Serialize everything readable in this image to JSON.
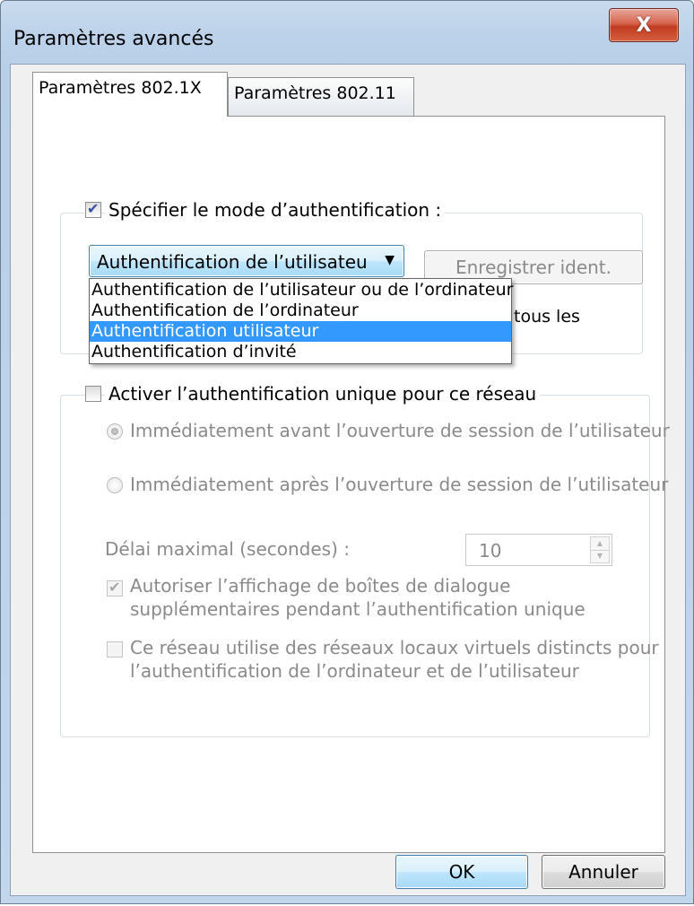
{
  "window": {
    "title": "Paramètres avancés",
    "close_glyph": "X"
  },
  "tabs": [
    {
      "label": "Paramètres 802.1X",
      "active": true
    },
    {
      "label": "Paramètres 802.11",
      "active": false
    }
  ],
  "auth_section": {
    "specify_mode_label": "Spécifier le mode d’authentification :",
    "specify_mode_checked": true,
    "mode_combo_value": "Authentification de l’utilisateur ou de l’ordinateur",
    "save_credentials_label": "Enregistrer ident.",
    "partially_hidden_text": "tous les",
    "dropdown_options": [
      {
        "label": "Authentification de l’utilisateur ou de l’ordinateur",
        "selected": false
      },
      {
        "label": "Authentification de l’ordinateur",
        "selected": false
      },
      {
        "label": "Authentification utilisateur",
        "selected": true
      },
      {
        "label": "Authentification d’invité",
        "selected": false
      }
    ]
  },
  "sso_section": {
    "enable_sso_label": "Activer l’authentification unique pour ce réseau",
    "enable_sso_checked": false,
    "radio_before_label": "Immédiatement avant l’ouverture de session de l’utilisateur",
    "radio_before_checked": true,
    "radio_after_label": "Immédiatement après l’ouverture de session de l’utilisateur",
    "radio_after_checked": false,
    "max_delay_label": "Délai maximal (secondes) :",
    "max_delay_value": "10",
    "allow_dialogs_line1": "Autoriser l’affichage de boîtes de dialogue",
    "allow_dialogs_line2": "supplémentaires pendant l’authentification unique",
    "allow_dialogs_checked": true,
    "vlan_line1": "Ce réseau utilise des réseaux locaux virtuels distincts pour",
    "vlan_line2": "l’authentification de l’ordinateur et de l’utilisateur",
    "vlan_checked": false
  },
  "footer": {
    "ok_label": "OK",
    "cancel_label": "Annuler"
  },
  "colors": {
    "selection": "#3399ff",
    "close_button": "#c8452a",
    "disabled_text": "#8a8a8a"
  }
}
